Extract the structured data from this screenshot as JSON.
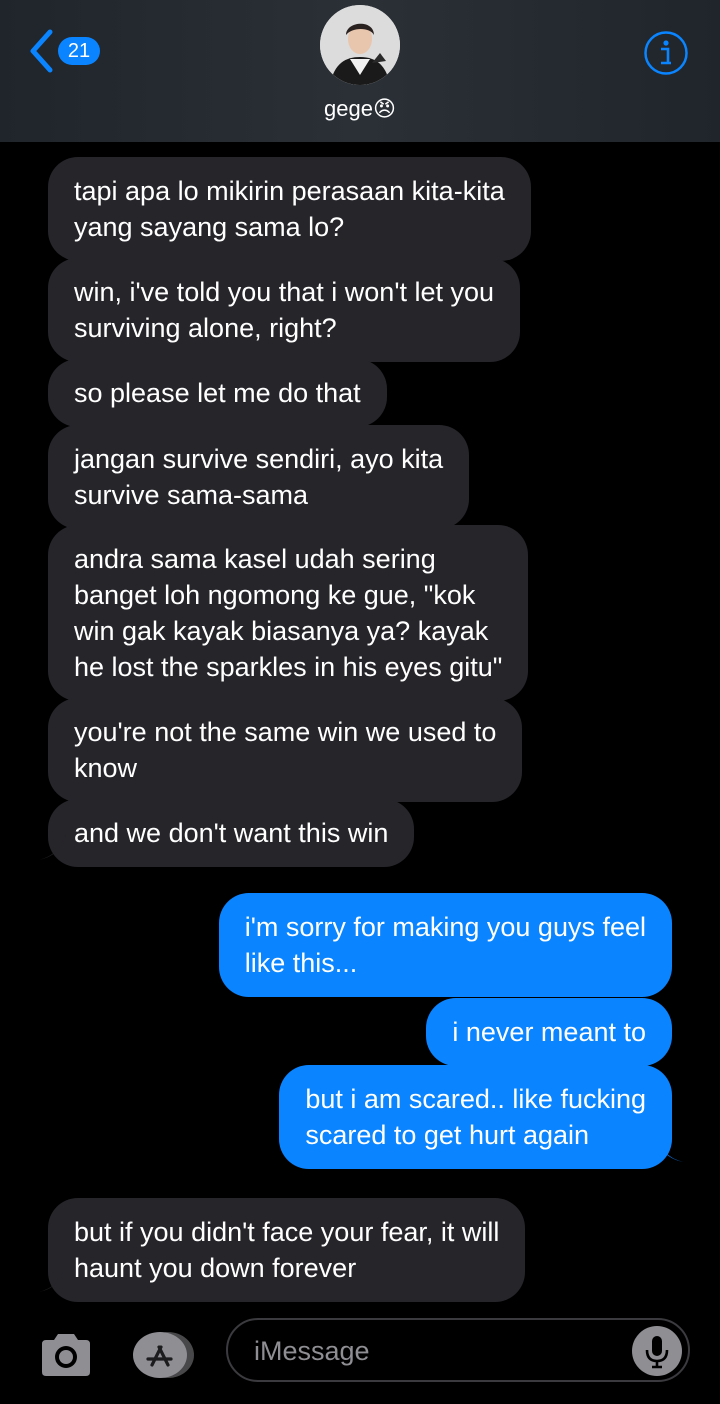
{
  "header": {
    "back_count": "21",
    "contact_name": "gege😠"
  },
  "messages": [
    {
      "dir": "in",
      "text": "tapi apa lo mikirin perasaan kita-kita\nyang sayang sama lo?"
    },
    {
      "dir": "in",
      "text": "win, i've told you that i won't let you\nsurviving alone, right?"
    },
    {
      "dir": "in",
      "text": "so please let me do that"
    },
    {
      "dir": "in",
      "text": "jangan survive sendiri, ayo kita\nsurvive sama-sama"
    },
    {
      "dir": "in",
      "text": "andra sama kasel udah sering\nbanget loh ngomong ke gue, \"kok\nwin gak kayak biasanya ya? kayak\nhe lost the sparkles in his eyes gitu\""
    },
    {
      "dir": "in",
      "text": "you're not the same win we used to\nknow"
    },
    {
      "dir": "in",
      "text": "and we don't want this win"
    },
    {
      "dir": "out",
      "text": "i'm sorry for making you guys feel\nlike this..."
    },
    {
      "dir": "out",
      "text": "i never meant to"
    },
    {
      "dir": "out",
      "text": "but i am scared.. like fucking\nscared to get hurt again"
    },
    {
      "dir": "in",
      "text": "but if you didn't face your fear, it will\nhaunt you down forever"
    }
  ],
  "composer": {
    "placeholder": "iMessage"
  },
  "icons": {
    "back": "chevron-left-icon",
    "info": "info-icon",
    "camera": "camera-icon",
    "appstore": "app-store-icon",
    "mic": "microphone-icon"
  },
  "colors": {
    "accent": "#0a84ff",
    "incoming_bubble": "#26252a",
    "background": "#000000"
  }
}
